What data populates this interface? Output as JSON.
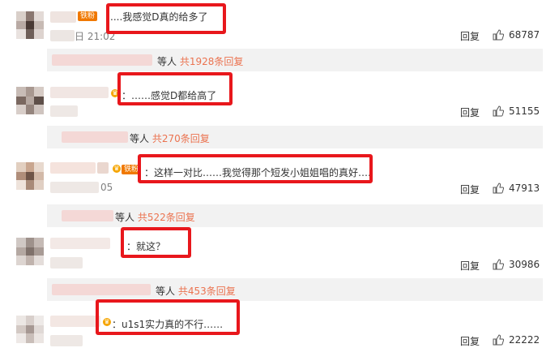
{
  "comments": [
    {
      "badge": "铁粉",
      "text": "....我感觉D真的给多了",
      "time": "日 21:02",
      "reply": "回复",
      "likes": "68787",
      "sub_prefix": "等人",
      "sub_count": "共1928条回复"
    },
    {
      "badge": "",
      "text": "：……感觉D都给高了",
      "time": "",
      "reply": "回复",
      "likes": "51155",
      "sub_prefix": "等人",
      "sub_count": "共270条回复"
    },
    {
      "badge": "铁粉",
      "text": "：这样一对比……我觉得那个短发小姐姐唱的真好….",
      "time": "05",
      "reply": "回复",
      "likes": "47913",
      "sub_prefix": "等人",
      "sub_count": "共522条回复"
    },
    {
      "badge": "",
      "text": "：就这？",
      "time": "",
      "reply": "回复",
      "likes": "30986",
      "sub_prefix": "等人",
      "sub_count": "共453条回复"
    },
    {
      "badge": "",
      "text": "：u1s1实力真的不行……",
      "time": "",
      "reply": "回复",
      "likes": "22222"
    }
  ],
  "icons": {
    "like": "thumbs-up-icon",
    "vip": "vip-crown-icon"
  },
  "colors": {
    "highlight": "#e8171c",
    "count": "#eb7350",
    "badge": "#f07800",
    "subbg": "#f2f2f2"
  }
}
